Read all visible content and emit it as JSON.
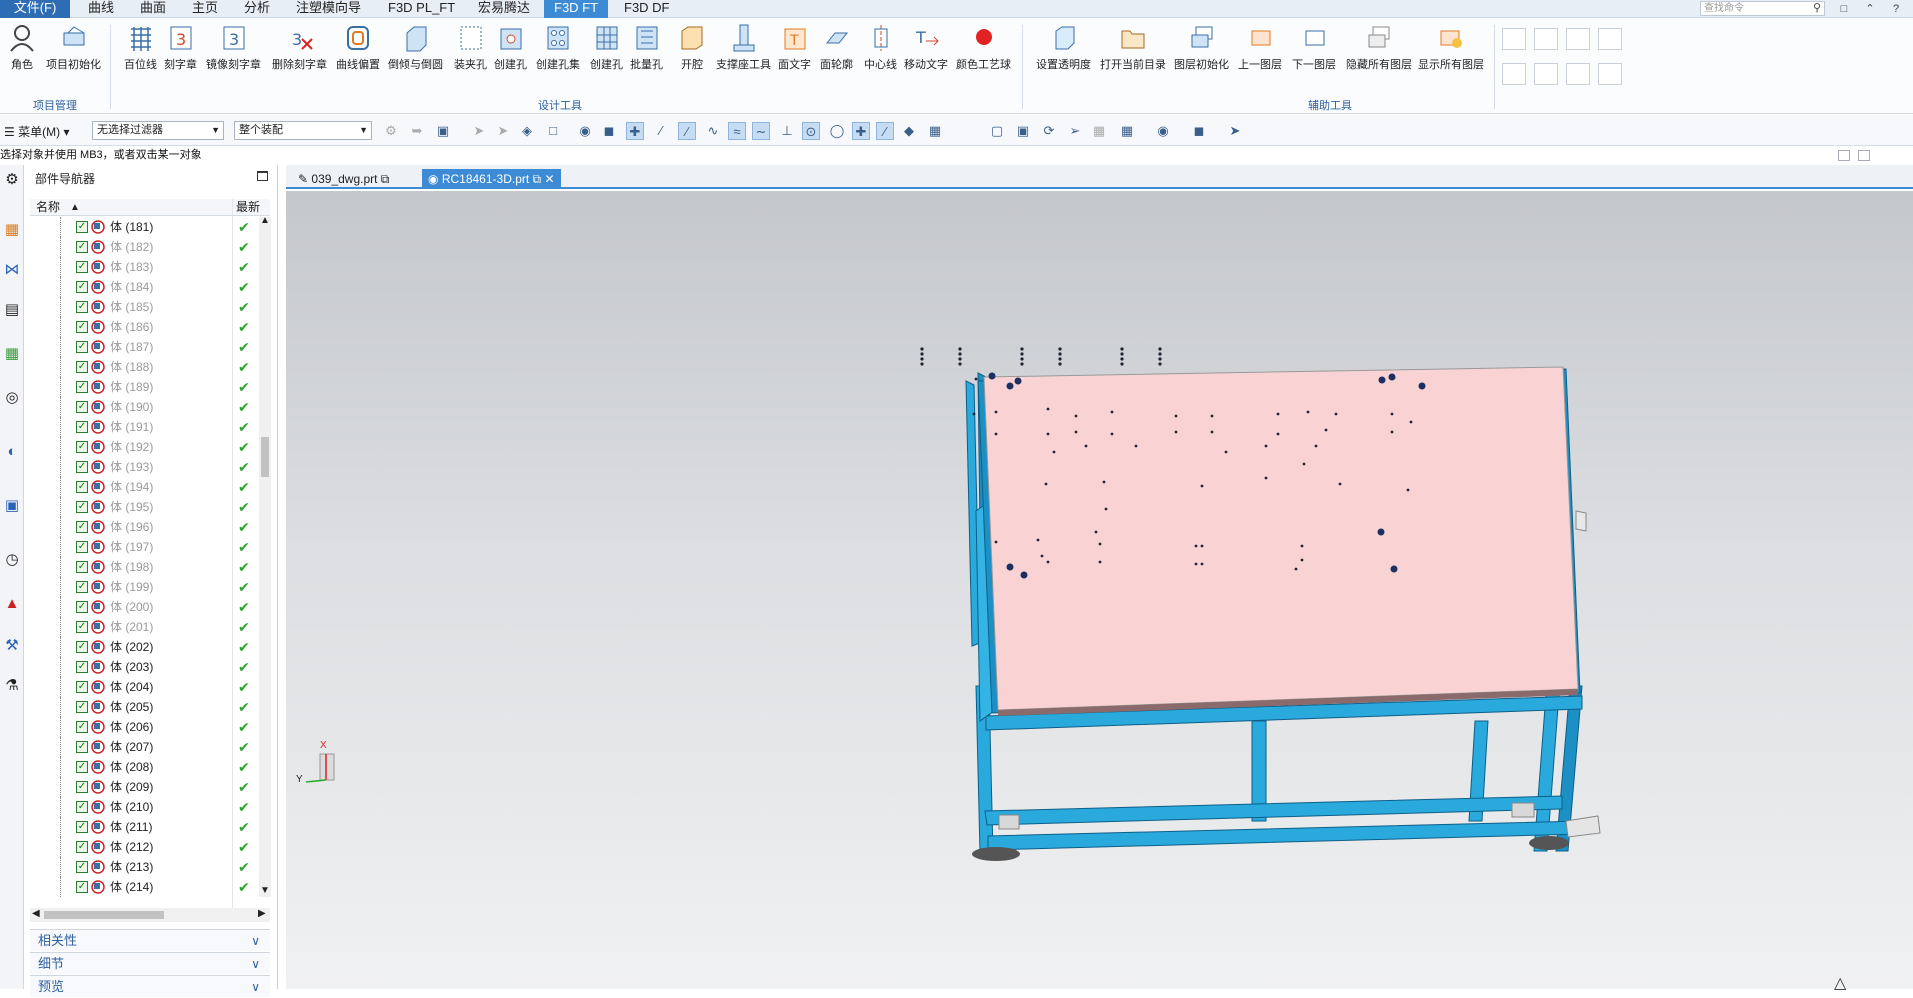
{
  "menu": {
    "tabs": [
      "文件(F)",
      "曲线",
      "曲面",
      "主页",
      "分析",
      "注塑模向导",
      "F3D PL_FT",
      "宏易腾达",
      "F3D FT",
      "F3D DF"
    ],
    "active_tab": "F3D FT",
    "search_placeholder": "查找命令"
  },
  "ribbon": {
    "groups": [
      {
        "label": "项目管理",
        "buttons": [
          "角色",
          "项目初始化"
        ]
      },
      {
        "label": "设计工具",
        "buttons": [
          "百位线",
          "刻字章",
          "镜像刻字章",
          "删除刻字章",
          "曲线偏置",
          "倒倾与倒圆",
          "装夹孔",
          "创建孔",
          "创建孔集",
          "创建孔",
          "批量孔",
          "开腔",
          "支撑座工具",
          "面文字",
          "面轮廓",
          "中心线",
          "移动文字",
          "颜色工艺球"
        ]
      },
      {
        "label": "辅助工具",
        "buttons": [
          "设置透明度",
          "打开当前目录",
          "图层初始化",
          "上一图层",
          "下一图层",
          "隐藏所有图层",
          "显示所有图层"
        ]
      }
    ]
  },
  "toolbar": {
    "menu_label": "菜单(M)",
    "filter_value": "无选择过滤器",
    "scope_value": "整个装配"
  },
  "status": {
    "prompt": "选择对象并使用 MB3，或者双击某一对象"
  },
  "navigator": {
    "title": "部件导航器",
    "col_name": "名称",
    "col_latest": "最新",
    "rows": [
      {
        "label": "体 (181)",
        "dim": false
      },
      {
        "label": "体 (182)",
        "dim": true
      },
      {
        "label": "体 (183)",
        "dim": true
      },
      {
        "label": "体 (184)",
        "dim": true
      },
      {
        "label": "体 (185)",
        "dim": true
      },
      {
        "label": "体 (186)",
        "dim": true
      },
      {
        "label": "体 (187)",
        "dim": true
      },
      {
        "label": "体 (188)",
        "dim": true
      },
      {
        "label": "体 (189)",
        "dim": true
      },
      {
        "label": "体 (190)",
        "dim": true
      },
      {
        "label": "体 (191)",
        "dim": true
      },
      {
        "label": "体 (192)",
        "dim": true
      },
      {
        "label": "体 (193)",
        "dim": true
      },
      {
        "label": "体 (194)",
        "dim": true
      },
      {
        "label": "体 (195)",
        "dim": true
      },
      {
        "label": "体 (196)",
        "dim": true
      },
      {
        "label": "体 (197)",
        "dim": true
      },
      {
        "label": "体 (198)",
        "dim": true
      },
      {
        "label": "体 (199)",
        "dim": true
      },
      {
        "label": "体 (200)",
        "dim": true
      },
      {
        "label": "体 (201)",
        "dim": true
      },
      {
        "label": "体 (202)",
        "dim": false
      },
      {
        "label": "体 (203)",
        "dim": false
      },
      {
        "label": "体 (204)",
        "dim": false
      },
      {
        "label": "体 (205)",
        "dim": false
      },
      {
        "label": "体 (206)",
        "dim": false
      },
      {
        "label": "体 (207)",
        "dim": false
      },
      {
        "label": "体 (208)",
        "dim": false
      },
      {
        "label": "体 (209)",
        "dim": false
      },
      {
        "label": "体 (210)",
        "dim": false
      },
      {
        "label": "体 (211)",
        "dim": false
      },
      {
        "label": "体 (212)",
        "dim": false
      },
      {
        "label": "体 (213)",
        "dim": false
      },
      {
        "label": "体 (214)",
        "dim": false
      }
    ],
    "panels": [
      "相关性",
      "细节",
      "预览"
    ]
  },
  "doc_tabs": [
    {
      "label": "039_dwg.prt",
      "active": false
    },
    {
      "label": "RC18461-3D.prt",
      "active": true
    }
  ],
  "triad": {
    "x": "X",
    "y": "Y"
  },
  "colors": {
    "accent": "#3e8bd5",
    "plate": "#fad3d3",
    "frame": "#1ea7dc"
  }
}
